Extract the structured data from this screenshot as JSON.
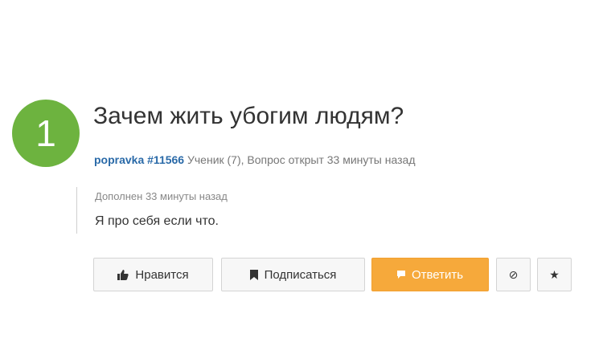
{
  "question": {
    "number": "1",
    "title": "Зачем жить убогим людям?",
    "author": "popravka #11566",
    "meta": "Ученик (7), Вопрос открыт 33 минуты назад"
  },
  "addendum": {
    "label": "Дополнен 33 минуты назад",
    "text": "Я про себя если что."
  },
  "actions": {
    "like_label": "Нравится",
    "subscribe_label": "Подписаться",
    "reply_label": "Ответить",
    "block_icon": "⊘",
    "star_icon": "★"
  },
  "colors": {
    "badge": "#6db33f",
    "author_link": "#2a6aa8",
    "reply_button": "#f6a93b"
  }
}
